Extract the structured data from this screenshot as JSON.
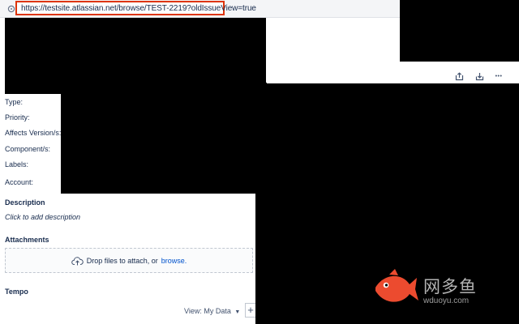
{
  "browser": {
    "url": "https://testsite.atlassian.net/browse/TEST-2219?oldIssueView=true"
  },
  "toolbar": {
    "share_icon": "share-icon",
    "export_icon": "export-icon",
    "more_icon": "more-icon",
    "more_glyph": "•••"
  },
  "details": {
    "fields": [
      {
        "label": "Type:"
      },
      {
        "label": "Priority:"
      },
      {
        "label": "Affects Version/s:"
      },
      {
        "label": "Component/s:"
      },
      {
        "label": "Labels:"
      },
      {
        "label": "Account:"
      }
    ]
  },
  "description": {
    "title": "Description",
    "placeholder": "Click to add description"
  },
  "attachments": {
    "title": "Attachments",
    "drop_text": "Drop files to attach, or",
    "browse_text": "browse."
  },
  "tempo": {
    "title": "Tempo",
    "view_label": "View: My Data",
    "plus": "+"
  },
  "watermark": {
    "chinese": "网多鱼",
    "domain": "wduoyu.com"
  },
  "colors": {
    "highlight": "#de350b",
    "link": "#0052cc",
    "redaction": "#000000",
    "watermark_fish": "#ec4b2f"
  }
}
